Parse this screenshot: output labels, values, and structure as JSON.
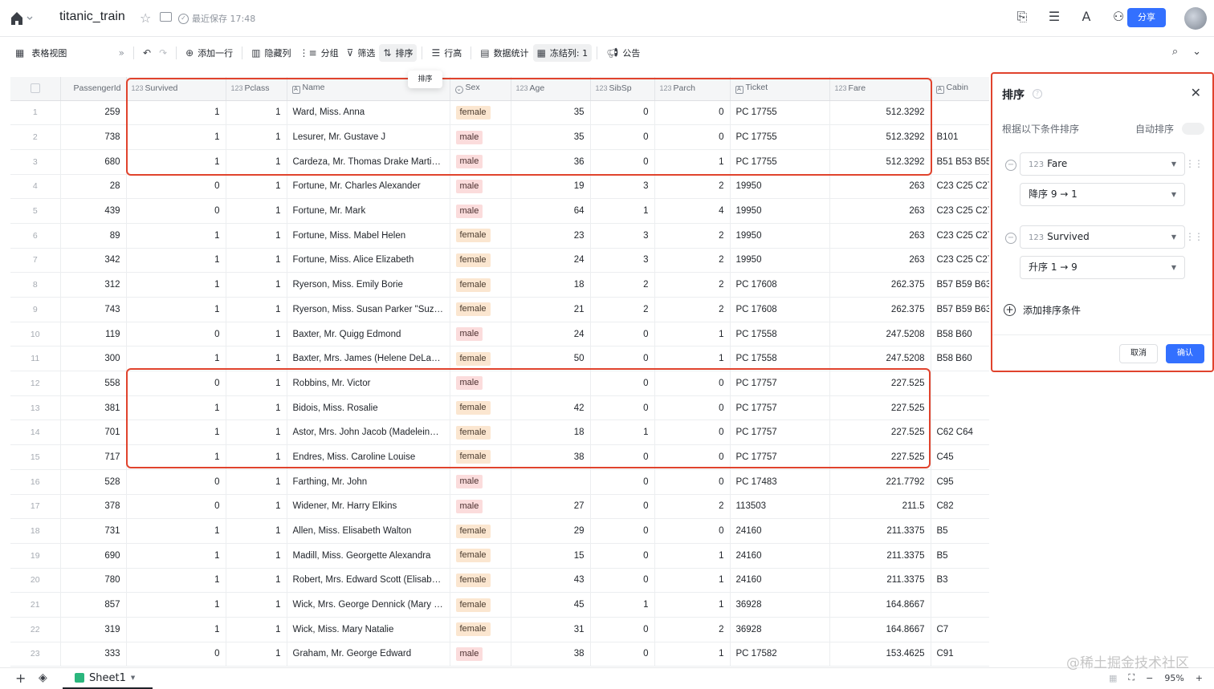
{
  "header": {
    "doc_title": "titanic_train",
    "save_status": "最近保存 17:48",
    "share_label": "分享"
  },
  "toolbar": {
    "view_name": "表格视图",
    "add_row": "添加一行",
    "hide_cols": "隐藏列",
    "group": "分组",
    "filter": "筛选",
    "sort": "排序",
    "row_height": "行高",
    "stats": "数据统计",
    "freeze": "冻结列: 1",
    "notice": "公告",
    "tooltip": "排序"
  },
  "table": {
    "columns": [
      {
        "key": "PassengerId",
        "label": "PassengerId",
        "icon": ""
      },
      {
        "key": "Survived",
        "label": "Survived",
        "icon": "123"
      },
      {
        "key": "Pclass",
        "label": "Pclass",
        "icon": "123"
      },
      {
        "key": "Name",
        "label": "Name",
        "icon": "A"
      },
      {
        "key": "Sex",
        "label": "Sex",
        "icon": "select"
      },
      {
        "key": "Age",
        "label": "Age",
        "icon": "123"
      },
      {
        "key": "SibSp",
        "label": "SibSp",
        "icon": "123"
      },
      {
        "key": "Parch",
        "label": "Parch",
        "icon": "123"
      },
      {
        "key": "Ticket",
        "label": "Ticket",
        "icon": "A"
      },
      {
        "key": "Fare",
        "label": "Fare",
        "icon": "123"
      },
      {
        "key": "Cabin",
        "label": "Cabin",
        "icon": "A"
      }
    ],
    "rows": [
      [
        "1",
        "259",
        "1",
        "1",
        "Ward, Miss. Anna",
        "female",
        "35",
        "0",
        "0",
        "PC 17755",
        "512.3292",
        ""
      ],
      [
        "2",
        "738",
        "1",
        "1",
        "Lesurer, Mr. Gustave J",
        "male",
        "35",
        "0",
        "0",
        "PC 17755",
        "512.3292",
        "B101"
      ],
      [
        "3",
        "680",
        "1",
        "1",
        "Cardeza, Mr. Thomas Drake Martinez",
        "male",
        "36",
        "0",
        "1",
        "PC 17755",
        "512.3292",
        "B51 B53 B55"
      ],
      [
        "4",
        "28",
        "0",
        "1",
        "Fortune, Mr. Charles Alexander",
        "male",
        "19",
        "3",
        "2",
        "19950",
        "263",
        "C23 C25 C27"
      ],
      [
        "5",
        "439",
        "0",
        "1",
        "Fortune, Mr. Mark",
        "male",
        "64",
        "1",
        "4",
        "19950",
        "263",
        "C23 C25 C27"
      ],
      [
        "6",
        "89",
        "1",
        "1",
        "Fortune, Miss. Mabel Helen",
        "female",
        "23",
        "3",
        "2",
        "19950",
        "263",
        "C23 C25 C27"
      ],
      [
        "7",
        "342",
        "1",
        "1",
        "Fortune, Miss. Alice Elizabeth",
        "female",
        "24",
        "3",
        "2",
        "19950",
        "263",
        "C23 C25 C27"
      ],
      [
        "8",
        "312",
        "1",
        "1",
        "Ryerson, Miss. Emily Borie",
        "female",
        "18",
        "2",
        "2",
        "PC 17608",
        "262.375",
        "B57 B59 B63"
      ],
      [
        "9",
        "743",
        "1",
        "1",
        "Ryerson, Miss. Susan Parker \"Suze...",
        "female",
        "21",
        "2",
        "2",
        "PC 17608",
        "262.375",
        "B57 B59 B63"
      ],
      [
        "10",
        "119",
        "0",
        "1",
        "Baxter, Mr. Quigg Edmond",
        "male",
        "24",
        "0",
        "1",
        "PC 17558",
        "247.5208",
        "B58 B60"
      ],
      [
        "11",
        "300",
        "1",
        "1",
        "Baxter, Mrs. James (Helene DeLaud...",
        "female",
        "50",
        "0",
        "1",
        "PC 17558",
        "247.5208",
        "B58 B60"
      ],
      [
        "12",
        "558",
        "0",
        "1",
        "Robbins, Mr. Victor",
        "male",
        "",
        "0",
        "0",
        "PC 17757",
        "227.525",
        ""
      ],
      [
        "13",
        "381",
        "1",
        "1",
        "Bidois, Miss. Rosalie",
        "female",
        "42",
        "0",
        "0",
        "PC 17757",
        "227.525",
        ""
      ],
      [
        "14",
        "701",
        "1",
        "1",
        "Astor, Mrs. John Jacob (Madeleine ...",
        "female",
        "18",
        "1",
        "0",
        "PC 17757",
        "227.525",
        "C62 C64"
      ],
      [
        "15",
        "717",
        "1",
        "1",
        "Endres, Miss. Caroline Louise",
        "female",
        "38",
        "0",
        "0",
        "PC 17757",
        "227.525",
        "C45"
      ],
      [
        "16",
        "528",
        "0",
        "1",
        "Farthing, Mr. John",
        "male",
        "",
        "0",
        "0",
        "PC 17483",
        "221.7792",
        "C95"
      ],
      [
        "17",
        "378",
        "0",
        "1",
        "Widener, Mr. Harry Elkins",
        "male",
        "27",
        "0",
        "2",
        "113503",
        "211.5",
        "C82"
      ],
      [
        "18",
        "731",
        "1",
        "1",
        "Allen, Miss. Elisabeth Walton",
        "female",
        "29",
        "0",
        "0",
        "24160",
        "211.3375",
        "B5"
      ],
      [
        "19",
        "690",
        "1",
        "1",
        "Madill, Miss. Georgette Alexandra",
        "female",
        "15",
        "0",
        "1",
        "24160",
        "211.3375",
        "B5"
      ],
      [
        "20",
        "780",
        "1",
        "1",
        "Robert, Mrs. Edward Scott (Elisabet...",
        "female",
        "43",
        "0",
        "1",
        "24160",
        "211.3375",
        "B3"
      ],
      [
        "21",
        "857",
        "1",
        "1",
        "Wick, Mrs. George Dennick (Mary H...",
        "female",
        "45",
        "1",
        "1",
        "36928",
        "164.8667",
        ""
      ],
      [
        "22",
        "319",
        "1",
        "1",
        "Wick, Miss. Mary Natalie",
        "female",
        "31",
        "0",
        "2",
        "36928",
        "164.8667",
        "C7"
      ],
      [
        "23",
        "333",
        "0",
        "1",
        "Graham, Mr. George Edward",
        "male",
        "38",
        "0",
        "1",
        "PC 17582",
        "153.4625",
        "C91"
      ]
    ]
  },
  "sort_panel": {
    "title": "排序",
    "subtitle": "根据以下条件排序",
    "auto_label": "自动排序",
    "rules": [
      {
        "field": "Fare",
        "order": "降序 9 → 1"
      },
      {
        "field": "Survived",
        "order": "升序 1 → 9"
      }
    ],
    "add_rule": "添加排序条件",
    "cancel": "取消",
    "confirm": "确认"
  },
  "footer": {
    "sheet_name": "Sheet1",
    "zoom": "95%",
    "watermark": "@稀土掘金技术社区"
  }
}
